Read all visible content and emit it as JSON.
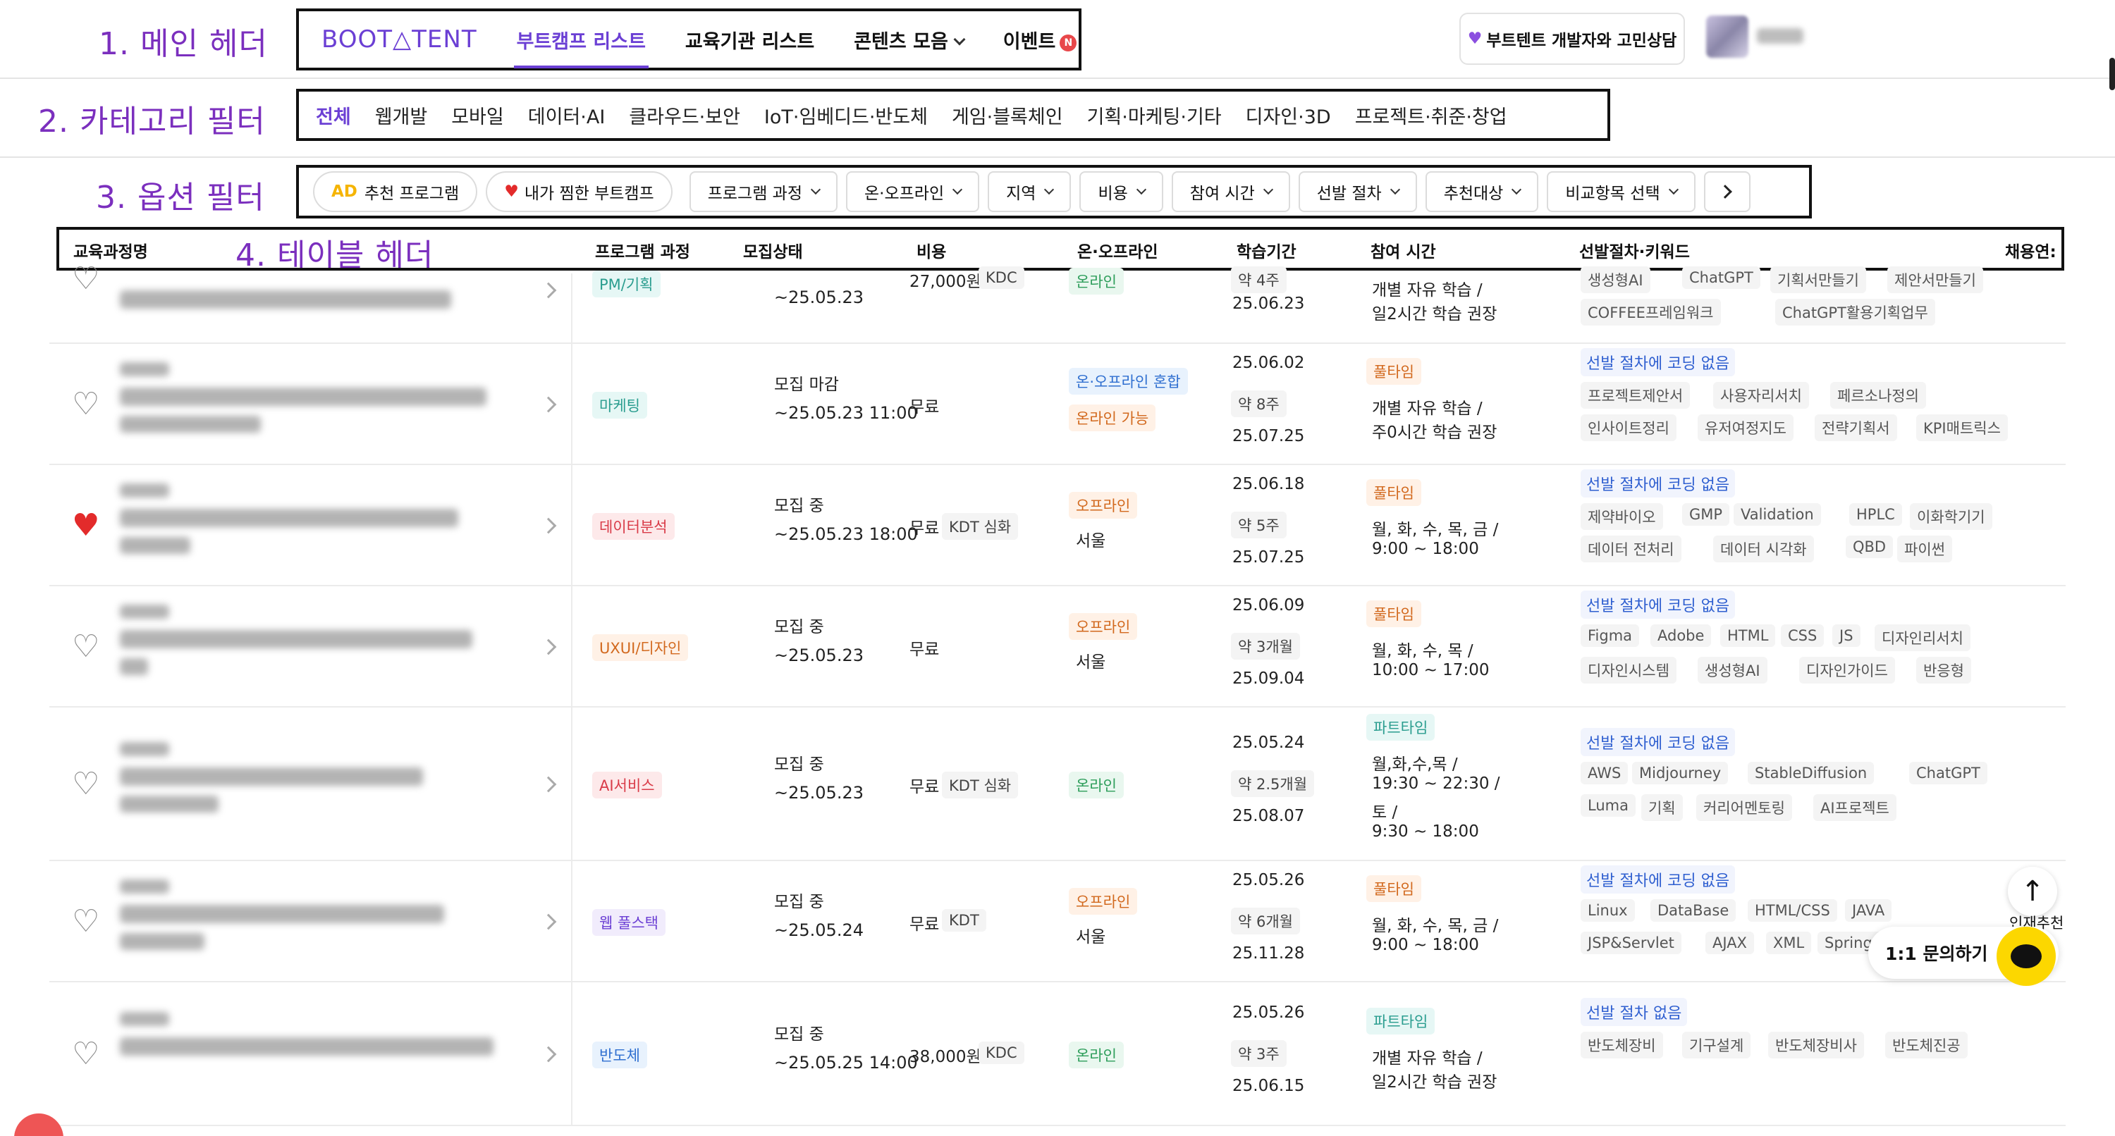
{
  "annotations": {
    "main_header": "1. 메인 헤더",
    "category_filter": "2. 카테고리 필터",
    "option_filter": "3. 옵션 필터",
    "table_header": "4. 테이블 헤더"
  },
  "header": {
    "logo": "BOOT△TENT",
    "nav": [
      {
        "label": "부트캠프 리스트"
      },
      {
        "label": "교육기관 리스트"
      },
      {
        "label": "콘텐츠 모음"
      },
      {
        "label": "이벤트"
      }
    ],
    "event_badge": "N",
    "consult_button": "부트텐트 개발자와 고민상담",
    "consult_icon": "purple-heart-icon"
  },
  "categories": [
    "전체",
    "웹개발",
    "모바일",
    "데이터·AI",
    "클라우드·보안",
    "IoT·임베디드·반도체",
    "게임·블록체인",
    "기획·마케팅·기타",
    "디자인·3D",
    "프로젝트·취준·창업"
  ],
  "options": {
    "ad_label": "AD",
    "recommended": "추천 프로그램",
    "favorites": "내가 찜한 부트캠프",
    "dropdowns": [
      "프로그램 과정",
      "온·오프라인",
      "지역",
      "비용",
      "참여 시간",
      "선발 절차",
      "추천대상",
      "비교항목 선택"
    ]
  },
  "table": {
    "columns": [
      "교육과정명",
      "프로그램 과정",
      "모집상태",
      "비용",
      "온·오프라인",
      "학습기간",
      "참여 시간",
      "선발절차·키워드",
      "채용연:"
    ],
    "rows": [
      {
        "liked": false,
        "program": "PM/기획",
        "status": "",
        "deadline": "~25.05.23",
        "cost": "27,000원",
        "cost_tag": "KDC",
        "location_tags": [
          "온라인"
        ],
        "location_text": "",
        "start": "",
        "duration": "약 4주",
        "end": "25.06.23",
        "time_type": "",
        "time_lines": [
          "개별 자유 학습 /",
          "일2시간 학습 권장"
        ],
        "selection": "",
        "keywords": [
          [
            "생성형AI",
            "ChatGPT",
            "기획서만들기",
            "제안서만들기"
          ],
          [
            "COFFEE프레임워크",
            "ChatGPT활용기획업무"
          ]
        ]
      },
      {
        "liked": false,
        "program": "마케팅",
        "status": "모집 마감",
        "deadline": "~25.05.23 11:00",
        "cost": "무료",
        "cost_tag": "",
        "location_tags": [
          "온·오프라인 혼합",
          "온라인 가능"
        ],
        "location_text": "",
        "start": "25.06.02",
        "duration": "약 8주",
        "end": "25.07.25",
        "time_type": "풀타임",
        "time_lines": [
          "개별 자유 학습 /",
          "주0시간 학습 권장"
        ],
        "selection": "선발 절차에 코딩 없음",
        "keywords": [
          [
            "프로젝트제안서",
            "사용자리서치",
            "페르소나정의"
          ],
          [
            "인사이트정리",
            "유저여정지도",
            "전략기획서",
            "KPI매트릭스"
          ]
        ]
      },
      {
        "liked": true,
        "program": "데이터분석",
        "status": "모집 중",
        "deadline": "~25.05.23 18:00",
        "cost": "무료",
        "cost_tag": "KDT 심화",
        "location_tags": [
          "오프라인"
        ],
        "location_text": "서울",
        "start": "25.06.18",
        "duration": "약 5주",
        "end": "25.07.25",
        "time_type": "풀타임",
        "time_lines": [
          "월, 화, 수, 목, 금 /",
          "9:00 ~ 18:00"
        ],
        "selection": "선발 절차에 코딩 없음",
        "keywords": [
          [
            "제약바이오",
            "GMP",
            "Validation",
            "HPLC",
            "이화학기기"
          ],
          [
            "데이터 전처리",
            "데이터 시각화",
            "QBD",
            "파이썬"
          ]
        ]
      },
      {
        "liked": false,
        "program": "UXUI/디자인",
        "status": "모집 중",
        "deadline": "~25.05.23",
        "cost": "무료",
        "cost_tag": "",
        "location_tags": [
          "오프라인"
        ],
        "location_text": "서울",
        "start": "25.06.09",
        "duration": "약 3개월",
        "end": "25.09.04",
        "time_type": "풀타임",
        "time_lines": [
          "월, 화, 수, 목 /",
          "10:00 ~ 17:00"
        ],
        "selection": "선발 절차에 코딩 없음",
        "keywords": [
          [
            "Figma",
            "Adobe",
            "HTML",
            "CSS",
            "JS",
            "디자인리서치"
          ],
          [
            "디자인시스템",
            "생성형AI",
            "디자인가이드",
            "반응형"
          ]
        ]
      },
      {
        "liked": false,
        "program": "AI서비스",
        "status": "모집 중",
        "deadline": "~25.05.23",
        "cost": "무료",
        "cost_tag": "KDT 심화",
        "location_tags": [
          "온라인"
        ],
        "location_text": "",
        "start": "25.05.24",
        "duration": "약 2.5개월",
        "end": "25.08.07",
        "time_type": "파트타임",
        "time_lines": [
          "월,화,수,목 /",
          "19:30 ~ 22:30 /",
          "토 /",
          "9:30 ~ 18:00"
        ],
        "selection": "선발 절차에 코딩 없음",
        "keywords": [
          [
            "AWS",
            "Midjourney",
            "StableDiffusion",
            "ChatGPT"
          ],
          [
            "Luma",
            "기획",
            "커리어멘토링",
            "AI프로젝트"
          ]
        ]
      },
      {
        "liked": false,
        "program": "웹 풀스택",
        "status": "모집 중",
        "deadline": "~25.05.24",
        "cost": "무료",
        "cost_tag": "KDT",
        "location_tags": [
          "오프라인"
        ],
        "location_text": "서울",
        "start": "25.05.26",
        "duration": "약 6개월",
        "end": "25.11.28",
        "time_type": "풀타임",
        "time_lines": [
          "월, 화, 수, 목, 금 /",
          "9:00 ~ 18:00"
        ],
        "selection": "선발 절차에 코딩 없음",
        "keywords": [
          [
            "Linux",
            "DataBase",
            "HTML/CSS",
            "JAVA"
          ],
          [
            "JSP&Servlet",
            "AJAX",
            "XML",
            "SpringFram"
          ]
        ]
      },
      {
        "liked": false,
        "program": "반도체",
        "status": "모집 중",
        "deadline": "~25.05.25 14:00",
        "cost": "38,000원",
        "cost_tag": "KDC",
        "location_tags": [
          "온라인"
        ],
        "location_text": "",
        "start": "25.05.26",
        "duration": "약 3주",
        "end": "25.06.15",
        "time_type": "파트타임",
        "time_lines": [
          "개별 자유 학습 /",
          "일2시간 학습 권장"
        ],
        "selection": "선발 절차 없음",
        "keywords": [
          [
            "반도체장비",
            "기구설계",
            "반도체장비사",
            "반도체진공"
          ]
        ]
      }
    ]
  },
  "floating": {
    "chat_label": "1:1 문의하기",
    "side_text": "인재추천",
    "top_icon": "arrow-up-icon",
    "chat_icon": "chat-bubble-icon"
  }
}
